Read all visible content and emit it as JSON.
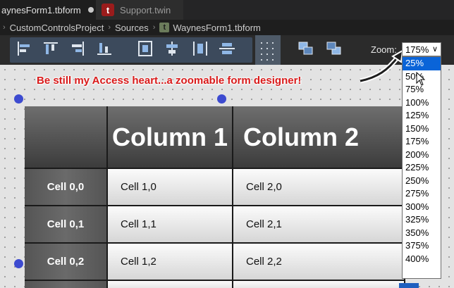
{
  "tabs": [
    {
      "label": "aynesForm1.tbform",
      "active": true
    },
    {
      "label": "Support.twin",
      "active": false,
      "icon": "t-icon"
    }
  ],
  "breadcrumb": [
    "CustomControlsProject",
    "Sources",
    "WaynesForm1.tbform"
  ],
  "toolbar": {
    "zoom_label": "Zoom:",
    "zoom_value": "175%"
  },
  "zoom_options": [
    "25%",
    "50%",
    "75%",
    "100%",
    "125%",
    "150%",
    "175%",
    "200%",
    "225%",
    "250%",
    "275%",
    "300%",
    "325%",
    "350%",
    "375%",
    "400%"
  ],
  "zoom_highlighted": "25%",
  "annotation": "Be still my Access heart...a zoomable form designer!",
  "grid": {
    "columns": [
      "",
      "Column 1",
      "Column 2"
    ],
    "rows": [
      [
        "Cell 0,0",
        "Cell 1,0",
        "Cell 2,0"
      ],
      [
        "Cell 0,1",
        "Cell 1,1",
        "Cell 2,1"
      ],
      [
        "Cell 0,2",
        "Cell 1,2",
        "Cell 2,2"
      ]
    ]
  },
  "colors": {
    "accent": "#0a64d8",
    "handle": "#3d4bd0",
    "callout": "#d91a1a"
  }
}
